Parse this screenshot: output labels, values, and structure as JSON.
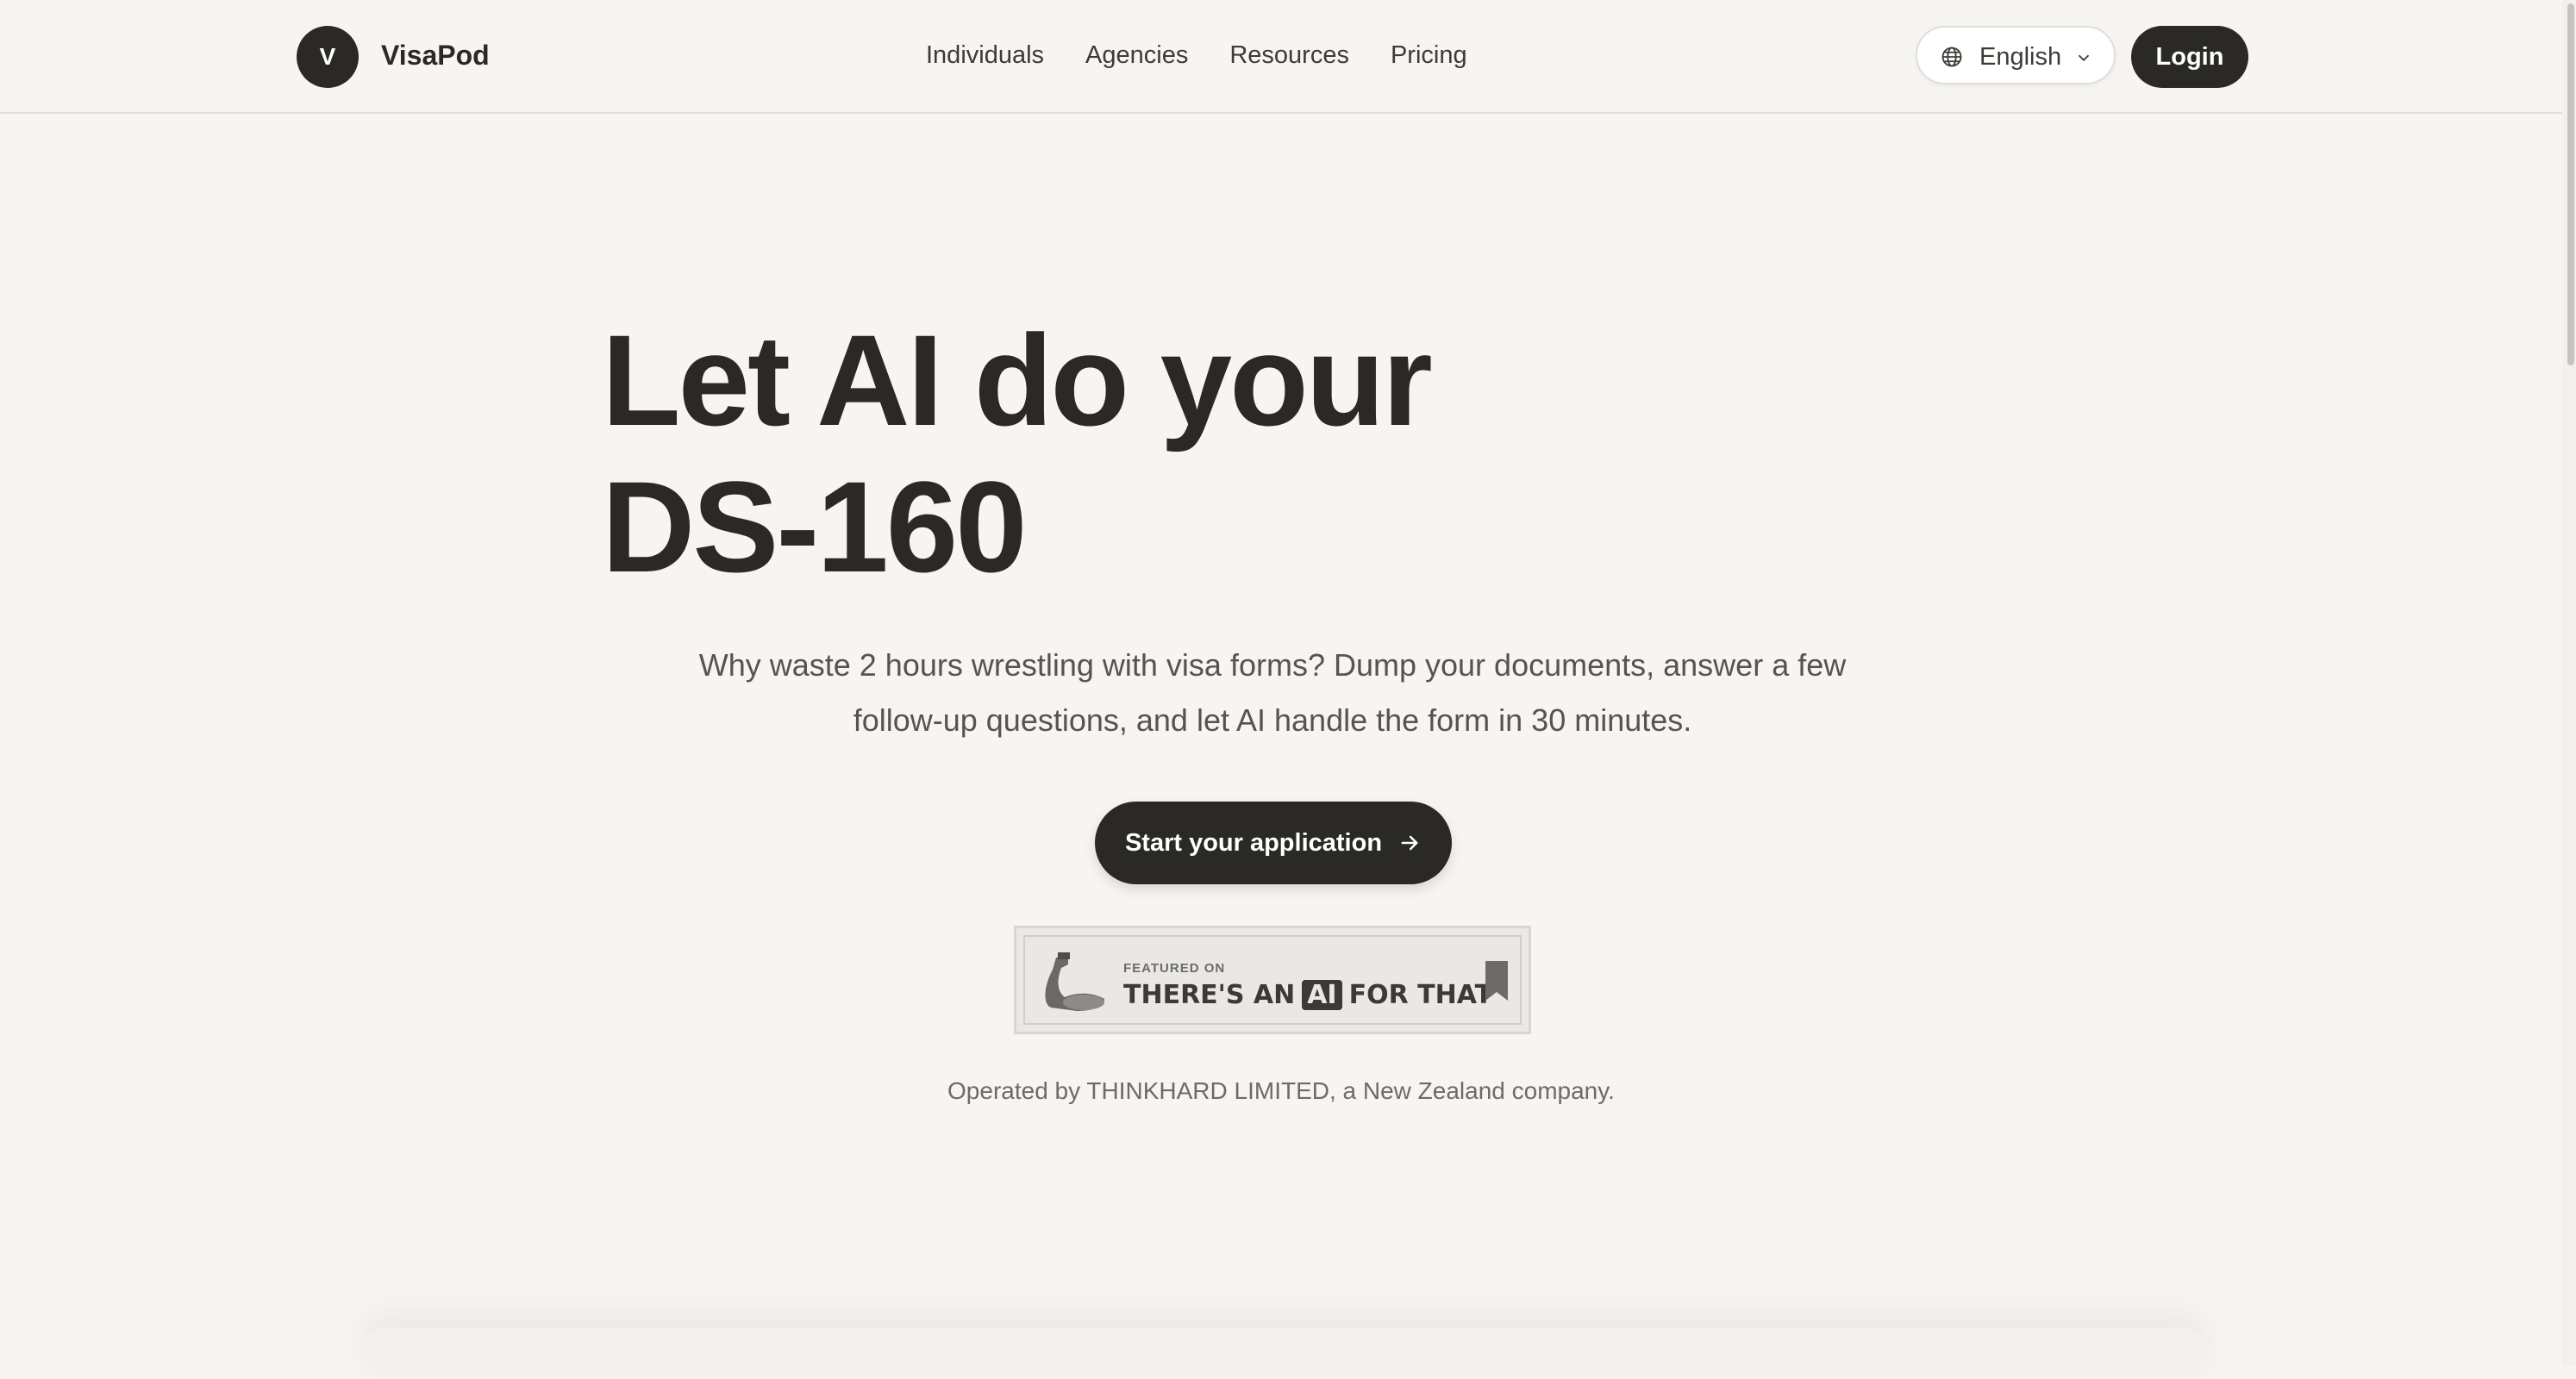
{
  "header": {
    "logo_letter": "V",
    "brand": "VisaPod",
    "nav": [
      "Individuals",
      "Agencies",
      "Resources",
      "Pricing"
    ],
    "language": "English",
    "login_label": "Login"
  },
  "hero": {
    "title_line1": "Let AI do your",
    "title_line2": "DS-160",
    "subtitle": "Why waste 2 hours wrestling with visa forms? Dump your documents, answer a few follow-up questions, and let AI handle the form in 30 minutes.",
    "cta_label": "Start your application"
  },
  "badge": {
    "featured": "FEATURED ON",
    "text_before": "THERE'S AN",
    "ai": "AI",
    "text_after": "FOR THAT"
  },
  "footer_note": "Operated by THINKHARD LIMITED, a New Zealand company.",
  "icons": {
    "language": "globe-icon",
    "dropdown": "chevron-down-icon",
    "cta": "arrow-right-icon",
    "badge_logo": "muscle-arm-icon",
    "badge_mark": "bookmark-icon"
  },
  "colors": {
    "background": "#f7f5f1",
    "primary": "#2b2925"
  }
}
